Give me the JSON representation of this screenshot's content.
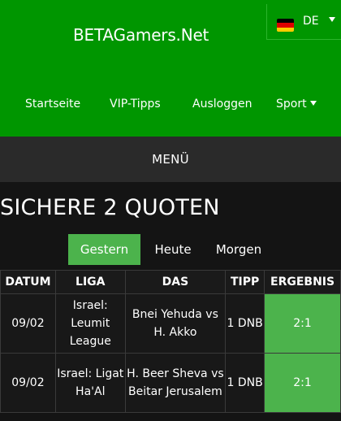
{
  "header": {
    "brand": "BETAGamers.Net",
    "language": {
      "code": "DE",
      "flag_colors": [
        "#000000",
        "#dd0000",
        "#ffcc00"
      ]
    },
    "nav": [
      {
        "label": "Startseite"
      },
      {
        "label": "VIP-Tipps"
      },
      {
        "label": "Ausloggen"
      },
      {
        "label": "Sport",
        "dropdown": true
      }
    ]
  },
  "menu": {
    "label": "MENÜ"
  },
  "main": {
    "title": "SICHERE 2 QUOTEN",
    "tabs": [
      {
        "label": "Gestern",
        "active": true
      },
      {
        "label": "Heute",
        "active": false
      },
      {
        "label": "Morgen",
        "active": false
      }
    ],
    "table": {
      "headers": [
        "DATUM",
        "LIGA",
        "DAS",
        "TIPP",
        "ERGEBNIS"
      ],
      "rows": [
        {
          "date": "09/02",
          "league": "Israel: Leumit League",
          "match": "Bnei Yehuda vs H. Akko",
          "tip": "1 DNB",
          "result": "2:1"
        },
        {
          "date": "09/02",
          "league": "Israel: Ligat Ha'Al",
          "match": "H. Beer Sheva vs Beitar Jerusalem",
          "tip": "1 DNB",
          "result": "2:1"
        }
      ]
    }
  },
  "colors": {
    "header_green": "#009600",
    "active_green": "#4cb34c",
    "menu_bar": "#2a2a2a",
    "background": "#141414"
  }
}
